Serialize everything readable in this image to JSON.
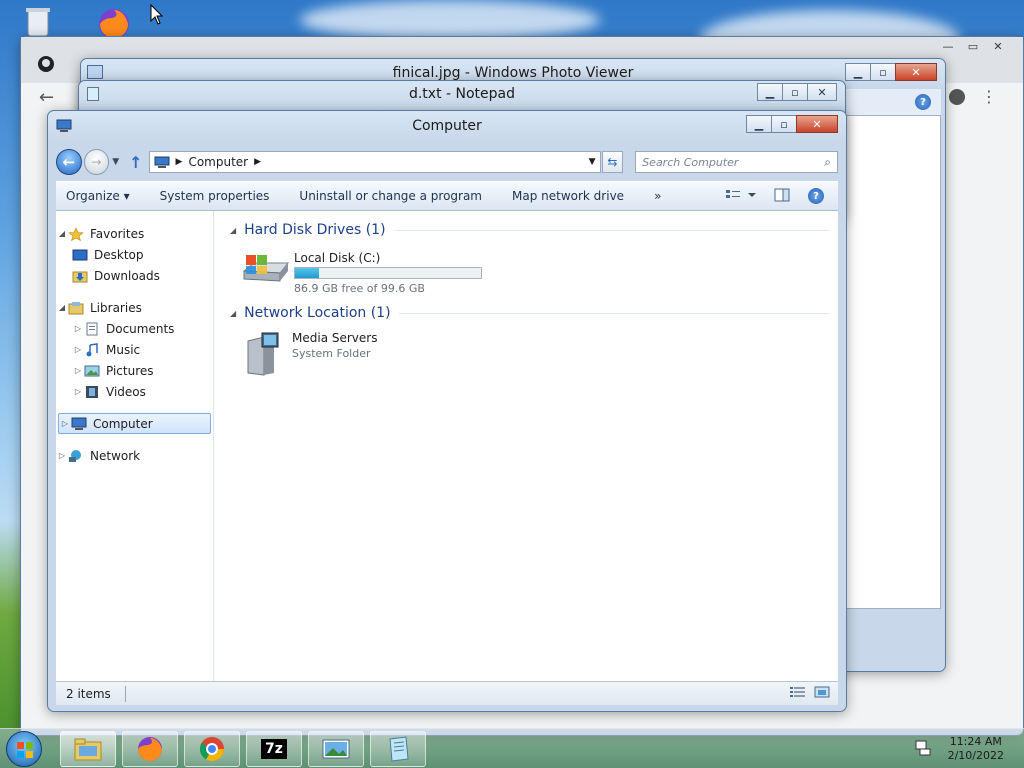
{
  "explorer": {
    "title": "Computer",
    "address": {
      "location": "Computer"
    },
    "search_placeholder": "Search Computer",
    "toolbar": {
      "organize": "Organize",
      "system_properties": "System properties",
      "uninstall": "Uninstall or change a program",
      "map_drive": "Map network drive",
      "more": "»"
    },
    "nav": {
      "favorites": "Favorites",
      "desktop": "Desktop",
      "downloads": "Downloads",
      "libraries": "Libraries",
      "documents": "Documents",
      "music": "Music",
      "pictures": "Pictures",
      "videos": "Videos",
      "computer": "Computer",
      "network": "Network"
    },
    "groups": {
      "hard_disks": "Hard Disk Drives (1)",
      "network_location": "Network Location (1)"
    },
    "drive": {
      "name": "Local Disk (C:)",
      "free_text": "86.9 GB free of 99.6 GB",
      "used_fraction": 0.128
    },
    "network_item": {
      "name": "Media Servers",
      "type": "System Folder"
    },
    "status": {
      "count": "2 items"
    }
  },
  "photo_viewer": {
    "title": "finical.jpg - Windows Photo Viewer"
  },
  "notepad": {
    "title": "d.txt - Notepad"
  },
  "clock": {
    "time": "11:24 AM",
    "date": "2/10/2022"
  },
  "taskbar": {
    "seven_zip": "7z"
  },
  "colors": {
    "title_blue": "#1e3f8a",
    "drive_fill": "#1f9acf"
  }
}
